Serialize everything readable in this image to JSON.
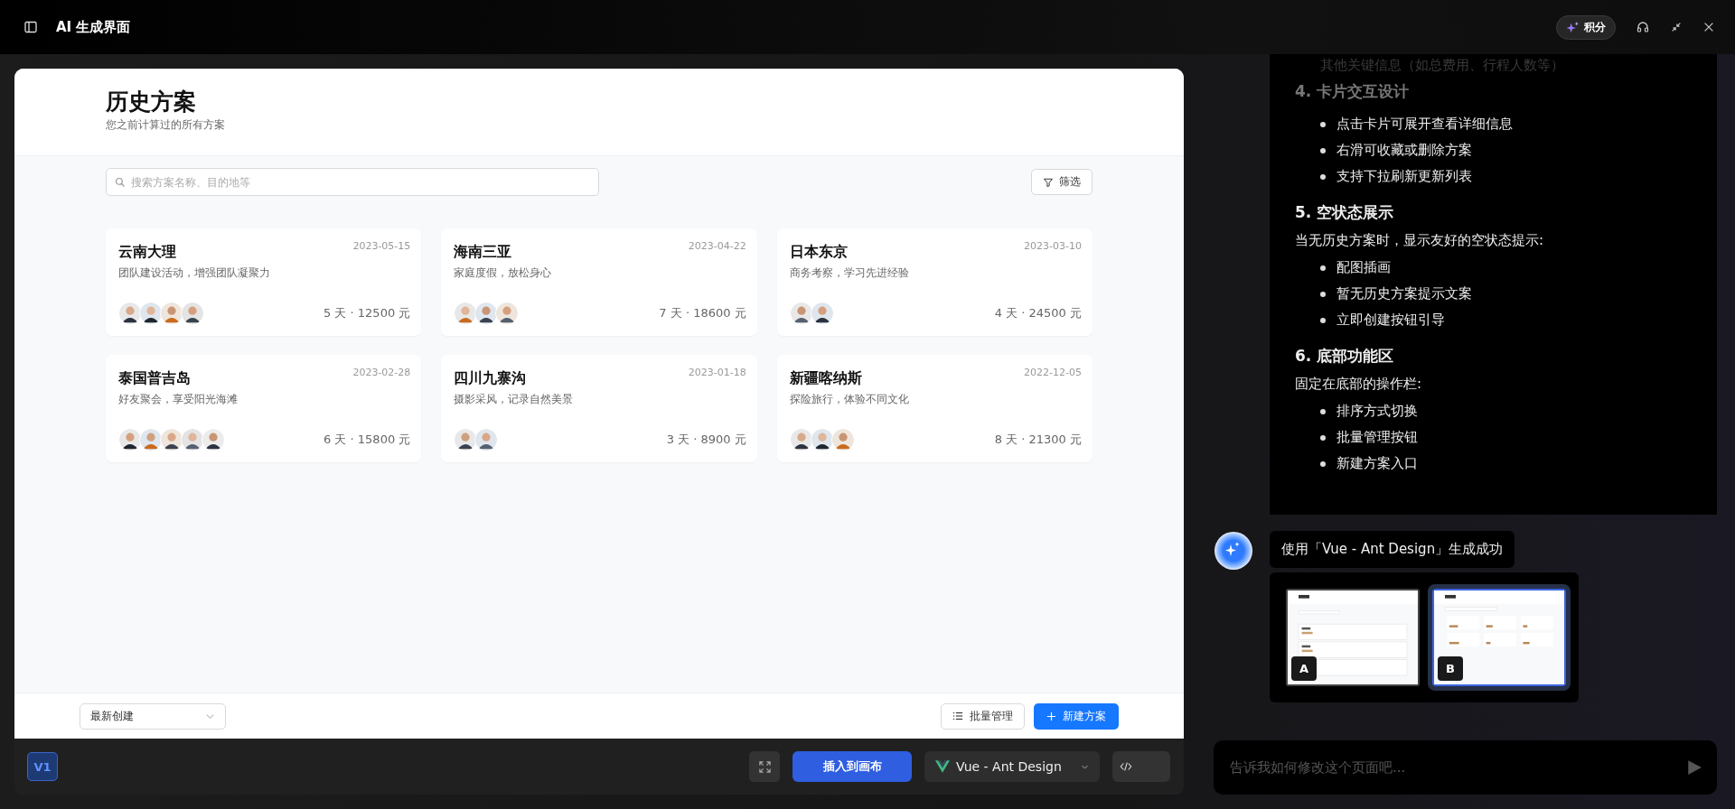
{
  "window": {
    "title": "AI 生成界面",
    "points_label": "积分"
  },
  "preview": {
    "title": "历史方案",
    "subtitle": "您之前计算过的所有方案",
    "search": {
      "placeholder": "搜索方案名称、目的地等"
    },
    "filter_label": "筛选",
    "plans": [
      {
        "name": "云南大理",
        "date": "2023-05-15",
        "description": "团队建设活动，增强团队凝聚力",
        "summary": "5 天 · 12500 元",
        "avatars": [
          {
            "kind": "photo"
          },
          {
            "kind": "photo"
          },
          {
            "kind": "photo"
          },
          {
            "kind": "photo"
          }
        ]
      },
      {
        "name": "海南三亚",
        "date": "2023-04-22",
        "description": "家庭度假，放松身心",
        "summary": "7 天 · 18600 元",
        "avatars": [
          {
            "kind": "photo"
          },
          {
            "kind": "photo"
          },
          {
            "kind": "photo"
          }
        ]
      },
      {
        "name": "日本东京",
        "date": "2023-03-10",
        "description": "商务考察，学习先进经验",
        "summary": "4 天 · 24500 元",
        "avatars": [
          {
            "kind": "photo"
          },
          {
            "kind": "photo"
          }
        ]
      },
      {
        "name": "泰国普吉岛",
        "date": "2023-02-28",
        "description": "好友聚会，享受阳光海滩",
        "summary": "6 天 · 15800 元",
        "avatars": [
          {
            "kind": "photo"
          },
          {
            "kind": "photo"
          },
          {
            "kind": "photo"
          },
          {
            "kind": "photo"
          },
          {
            "kind": "photo"
          }
        ]
      },
      {
        "name": "四川九寨沟",
        "date": "2023-01-18",
        "description": "摄影采风，记录自然美景",
        "summary": "3 天 · 8900 元",
        "avatars": [
          {
            "kind": "photo"
          },
          {
            "kind": "photo"
          }
        ]
      },
      {
        "name": "新疆喀纳斯",
        "date": "2022-12-05",
        "description": "探险旅行，体验不同文化",
        "summary": "8 天 · 21300 元",
        "avatars": [
          {
            "kind": "photo"
          },
          {
            "kind": "photo"
          },
          {
            "kind": "photo"
          }
        ]
      }
    ],
    "sort_value": "最新创建",
    "batch_label": "批量管理",
    "new_label": "新建方案"
  },
  "toolbar": {
    "version": "V1",
    "insert_label": "插入到画布",
    "framework": "Vue - Ant Design"
  },
  "chat": {
    "faded_item": "其他关键信息（如总费用、行程人数等）",
    "sections": [
      {
        "heading": "4. 卡片交互设计",
        "items": [
          "点击卡片可展开查看详细信息",
          "右滑可收藏或删除方案",
          "支持下拉刷新更新列表"
        ]
      },
      {
        "heading": "5. 空状态展示",
        "intro": "当无历史方案时，显示友好的空状态提示:",
        "items": [
          "配图插画",
          "暂无历史方案提示文案",
          "立即创建按钮引导"
        ]
      },
      {
        "heading": "6. 底部功能区",
        "intro": "固定在底部的操作栏:",
        "items": [
          "排序方式切换",
          "批量管理按钮",
          "新建方案入口"
        ]
      }
    ],
    "result_message": "使用「Vue - Ant Design」生成成功",
    "variants": [
      {
        "label": "A",
        "kind": "list",
        "selected": false
      },
      {
        "label": "B",
        "kind": "grid",
        "selected": true
      }
    ],
    "input": {
      "placeholder": "告诉我如何修改这个页面吧..."
    }
  }
}
